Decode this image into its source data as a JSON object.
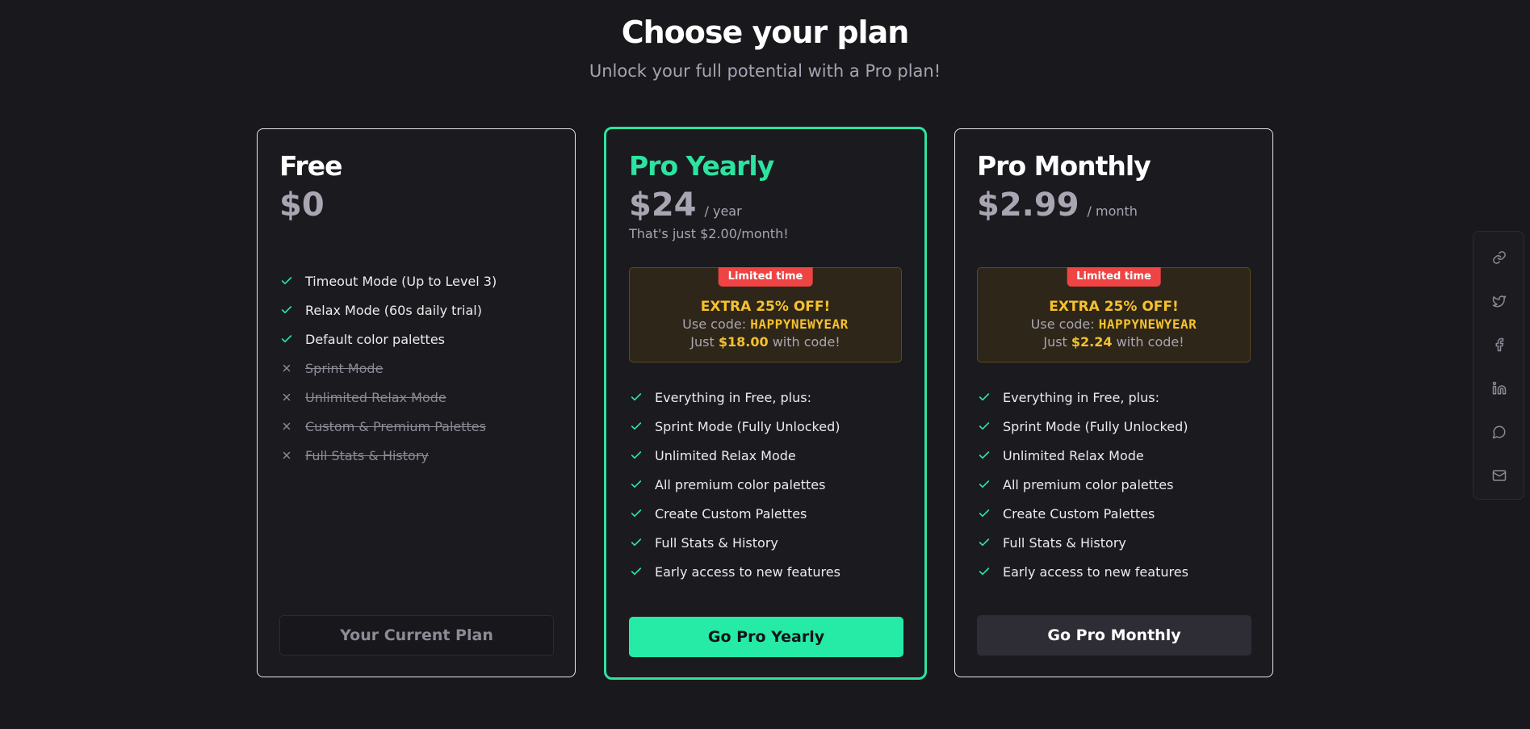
{
  "header": {
    "title": "Choose your plan",
    "subtitle": "Unlock your full potential with a Pro plan!"
  },
  "colors": {
    "accent": "#2ce3a0",
    "promo_yellow": "#f5c12e",
    "badge_red": "#ef4444"
  },
  "plans": [
    {
      "name": "Free",
      "price": "$0",
      "features": [
        {
          "label": "Timeout Mode (Up to Level 3)",
          "included": true
        },
        {
          "label": "Relax Mode (60s daily trial)",
          "included": true
        },
        {
          "label": "Default color palettes",
          "included": true
        },
        {
          "label": "Sprint Mode",
          "included": false
        },
        {
          "label": "Unlimited Relax Mode",
          "included": false
        },
        {
          "label": "Custom & Premium Palettes",
          "included": false
        },
        {
          "label": "Full Stats & History",
          "included": false
        }
      ],
      "button": "Your Current Plan"
    },
    {
      "name": "Pro Yearly",
      "price": "$24",
      "period": "/ year",
      "note": "That's just $2.00/month!",
      "promo": {
        "badge": "Limited time",
        "title": "EXTRA 25% OFF!",
        "code_prefix": "Use code:",
        "code": "HAPPYNEWYEAR",
        "just_prefix": "Just",
        "discounted_price": "$18.00",
        "just_suffix": "with code!"
      },
      "features": [
        {
          "label": "Everything in Free, plus:",
          "included": true
        },
        {
          "label": "Sprint Mode (Fully Unlocked)",
          "included": true
        },
        {
          "label": "Unlimited Relax Mode",
          "included": true
        },
        {
          "label": "All premium color palettes",
          "included": true
        },
        {
          "label": "Create Custom Palettes",
          "included": true
        },
        {
          "label": "Full Stats & History",
          "included": true
        },
        {
          "label": "Early access to new features",
          "included": true
        }
      ],
      "button": "Go Pro Yearly"
    },
    {
      "name": "Pro Monthly",
      "price": "$2.99",
      "period": "/ month",
      "promo": {
        "badge": "Limited time",
        "title": "EXTRA 25% OFF!",
        "code_prefix": "Use code:",
        "code": "HAPPYNEWYEAR",
        "just_prefix": "Just",
        "discounted_price": "$2.24",
        "just_suffix": "with code!"
      },
      "features": [
        {
          "label": "Everything in Free, plus:",
          "included": true
        },
        {
          "label": "Sprint Mode (Fully Unlocked)",
          "included": true
        },
        {
          "label": "Unlimited Relax Mode",
          "included": true
        },
        {
          "label": "All premium color palettes",
          "included": true
        },
        {
          "label": "Create Custom Palettes",
          "included": true
        },
        {
          "label": "Full Stats & History",
          "included": true
        },
        {
          "label": "Early access to new features",
          "included": true
        }
      ],
      "button": "Go Pro Monthly"
    }
  ],
  "share_icons": [
    "link-icon",
    "twitter-icon",
    "facebook-icon",
    "linkedin-icon",
    "chat-icon",
    "mail-icon"
  ]
}
